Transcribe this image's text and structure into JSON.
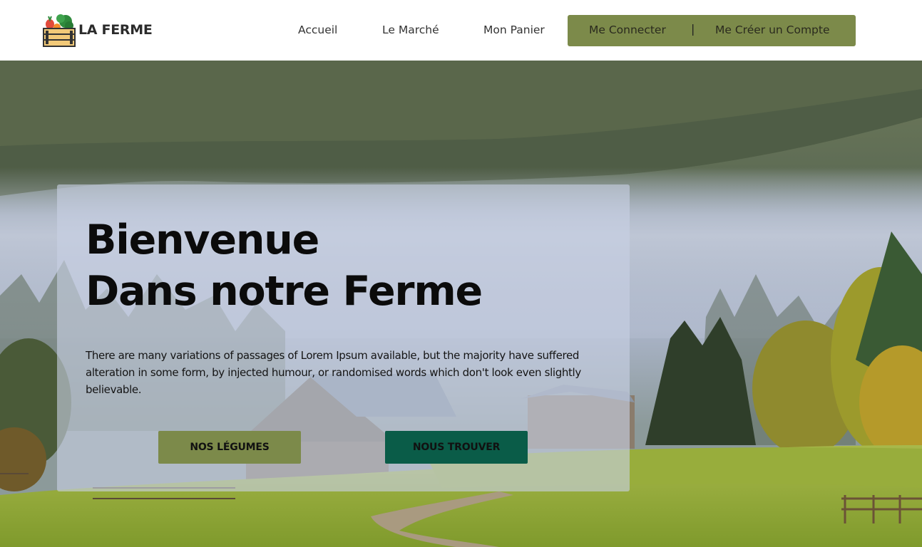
{
  "brand": {
    "name": "LA FERME",
    "logo_icon": "vegetable-crate-icon"
  },
  "nav": {
    "items": [
      {
        "label": "Accueil"
      },
      {
        "label": "Le Marché"
      },
      {
        "label": "Mon Panier"
      }
    ]
  },
  "auth": {
    "login_label": "Me Connecter",
    "separator": "|",
    "register_label": "Me Créer un Compte"
  },
  "hero": {
    "title_line1": "Bienvenue",
    "title_line2": "Dans notre Ferme",
    "description": "There are many variations of passages of Lorem Ipsum available, but the majority have suffered alteration in some form, by injected humour, or randomised words which don't look even slightly believable.",
    "buttons": {
      "vegetables": "NOS LÉGUMES",
      "find_us": "NOUS TROUVER"
    }
  },
  "colors": {
    "accent_green": "#7c8a4a",
    "dark_green": "#0a5c48",
    "header_bg": "#ffffff"
  }
}
